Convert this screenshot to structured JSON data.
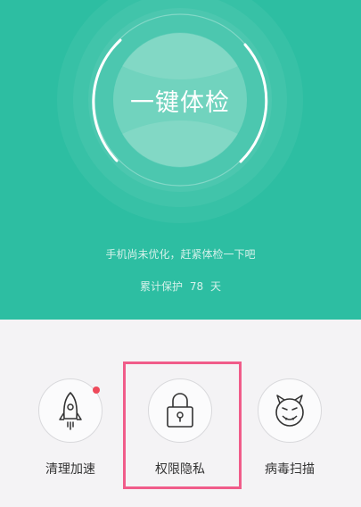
{
  "checkup": {
    "button_label": "一键体检"
  },
  "status": {
    "hint": "手机尚未优化，赶紧体检一下吧",
    "protect_prefix": "累计保护",
    "protect_days": "78",
    "protect_unit": "天"
  },
  "tools": [
    {
      "label": "清理加速",
      "icon": "rocket-icon",
      "has_badge": true
    },
    {
      "label": "权限隐私",
      "icon": "lock-icon",
      "selected": true
    },
    {
      "label": "病毒扫描",
      "icon": "devil-face-icon"
    }
  ],
  "colors": {
    "primary": "#2dbea2",
    "badge": "#ee4a5b",
    "highlight": "#f05c8a",
    "background": "#f4f3f5"
  }
}
